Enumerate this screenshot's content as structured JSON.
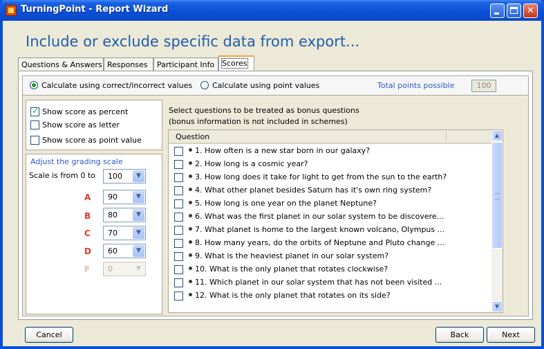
{
  "window": {
    "title": "TurningPoint - Report Wizard",
    "app_icon": "turningpoint-logo-icon"
  },
  "heading": "Include or exclude specific data from export...",
  "tabs": [
    {
      "label": "Questions & Answers",
      "active": false
    },
    {
      "label": "Responses",
      "active": false
    },
    {
      "label": "Participant Info",
      "active": false
    },
    {
      "label": "Scores",
      "active": true
    }
  ],
  "calc": {
    "option_correct": "Calculate using correct/incorrect values",
    "option_correct_selected": true,
    "option_points": "Calculate using point values",
    "option_points_selected": false,
    "total_points_label": "Total points possible",
    "total_points_value": "100"
  },
  "score_options": [
    {
      "label": "Show score as percent",
      "checked": true
    },
    {
      "label": "Show score as letter",
      "checked": false
    },
    {
      "label": "Show score as point value",
      "checked": false
    }
  ],
  "grading": {
    "title": "Adjust the grading scale",
    "scale_label": "Scale is from 0 to",
    "scale_value": "100",
    "grades": [
      {
        "letter": "A",
        "value": "90",
        "enabled": true
      },
      {
        "letter": "B",
        "value": "80",
        "enabled": true
      },
      {
        "letter": "C",
        "value": "70",
        "enabled": true
      },
      {
        "letter": "D",
        "value": "60",
        "enabled": true
      },
      {
        "letter": "F",
        "value": "0",
        "enabled": false
      }
    ]
  },
  "bonus": {
    "instruction_line1": "Select questions to be treated as bonus questions",
    "instruction_line2": "(bonus information is not included in schemes)",
    "column_header": "Question",
    "questions": [
      "1.  How often is a new star born in our galaxy?",
      "2.  How long is a cosmic year?",
      "3.  How long does it take for light to get from the sun to the earth?",
      "4.  What other planet besides Saturn has it's own ring system?",
      "5.  How long is one year on the planet Neptune?",
      "6.  What was the first planet in our solar system to be discovere...",
      "7.  What planet is home to the largest known volcano, Olympus ...",
      "8.  How many years, do the orbits of Neptune and Pluto change ...",
      "9.  What is the heaviest planet in our solar system?",
      "10.  What is the only planet that rotates clockwise?",
      "11.  Which  planet in our solar system that has not been visited ...",
      "12.  What is the only planet that rotates on its side?"
    ]
  },
  "footer": {
    "cancel": "Cancel",
    "back": "Back",
    "next": "Next"
  },
  "colors": {
    "title_bar": "#0a4fd6",
    "heading": "#1f5ea8",
    "grade_letters": "#e23a2a",
    "active_tab_accent": "#f1a43c"
  }
}
